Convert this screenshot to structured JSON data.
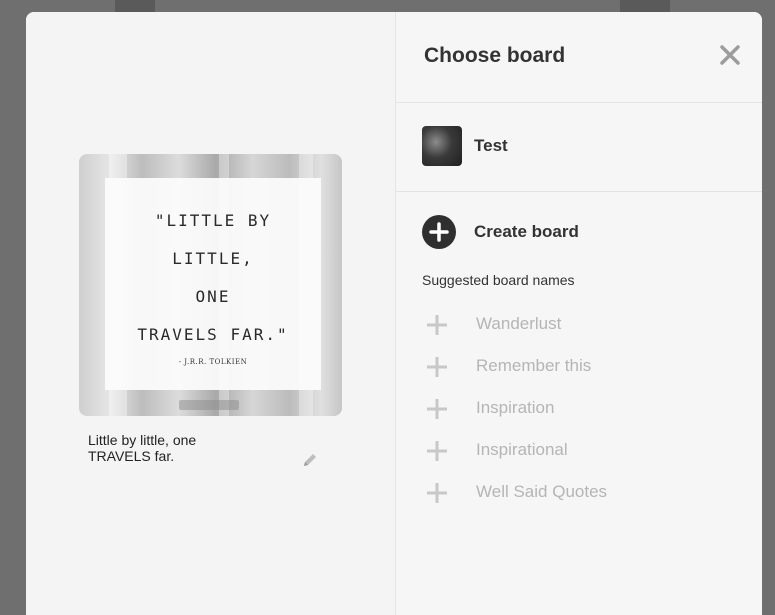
{
  "pin": {
    "quote_lines": [
      "\"LITTLE BY",
      "LITTLE,",
      "ONE",
      "TRAVELS FAR.\""
    ],
    "quote_author": "- J.R.R. TOLKIEN",
    "description_line1": "Little by little, one",
    "description_line2": "TRAVELS far."
  },
  "panel": {
    "title": "Choose board",
    "boards": [
      {
        "name": "Test"
      }
    ],
    "create_board_label": "Create board",
    "suggested_heading": "Suggested board names",
    "suggestions": [
      "Wanderlust",
      "Remember this",
      "Inspiration",
      "Inspirational",
      "Well Said Quotes"
    ]
  },
  "icons": {
    "close": "close-icon",
    "edit": "pencil-icon",
    "create": "plus-circle-icon",
    "suggestion": "plus-icon"
  },
  "colors": {
    "overlay": "#6f6f6f",
    "modal_bg": "#f5f5f5",
    "text_dark": "#333333",
    "suggestion_text": "#b5b5b5"
  }
}
